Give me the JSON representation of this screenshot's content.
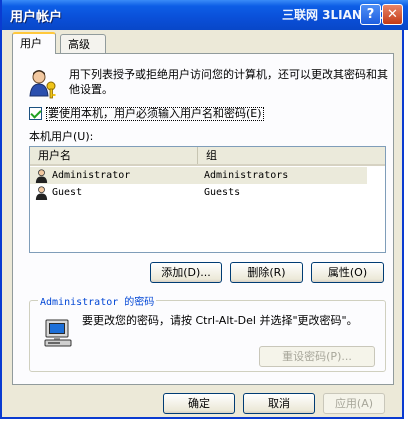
{
  "window": {
    "title": "用户帐户",
    "watermark": "三联网 3LIAN.COM"
  },
  "titlebar_buttons": {
    "help": "?",
    "close": "✕"
  },
  "tabs": [
    {
      "label": "用户"
    },
    {
      "label": "高级"
    }
  ],
  "intro_text": "用下列表授予或拒绝用户访问您的计算机，还可以更改其密码和其他设置。",
  "require_password": {
    "checked": true,
    "label": "要使用本机，用户必须输入用户名和密码(E)"
  },
  "users_label": "本机用户(U):",
  "list": {
    "columns": [
      "用户名",
      "组"
    ],
    "rows": [
      {
        "name": "Administrator",
        "group": "Administrators",
        "selected": true
      },
      {
        "name": "Guest",
        "group": "Guests",
        "selected": false
      }
    ]
  },
  "list_buttons": {
    "add": "添加(D)...",
    "remove": "删除(R)",
    "properties": "属性(O)"
  },
  "password_group": {
    "legend": "Administrator 的密码",
    "text": "要更改您的密码，请按 Ctrl-Alt-Del 并选择\"更改密码\"。",
    "reset_button": "重设密码(P)..."
  },
  "footer": {
    "ok": "确定",
    "cancel": "取消",
    "apply": "应用(A)"
  },
  "icons": {
    "users": "users-key-icon",
    "user_row": "user-icon",
    "computer": "computer-icon"
  }
}
